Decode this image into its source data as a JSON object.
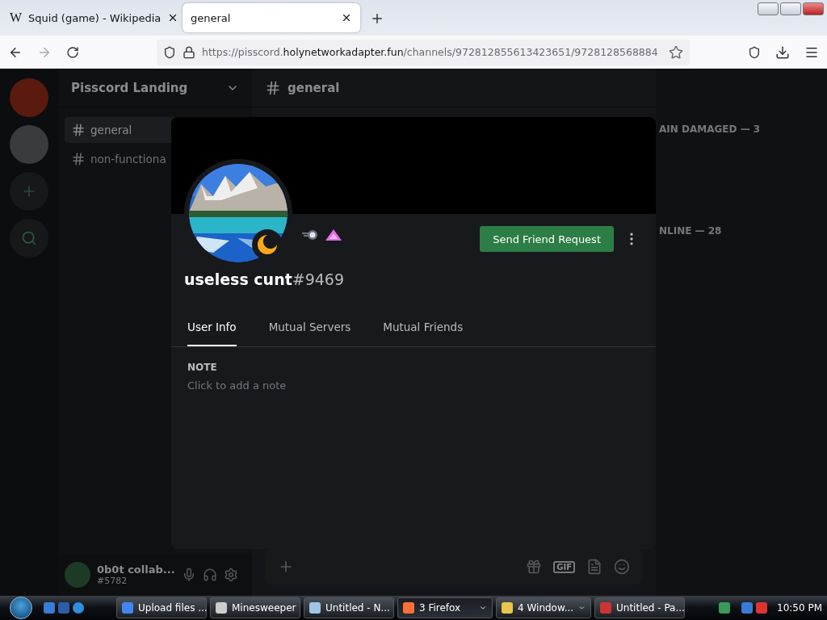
{
  "browser": {
    "tabs": [
      {
        "title": "Squid (game) - Wikipedia",
        "favicon": "W",
        "selected": false
      },
      {
        "title": "general",
        "selected": true
      }
    ],
    "url": {
      "scheme": "https://pisscord.",
      "host": "holynetworkadapter.fun",
      "path": "/channels/972812855613423651/9728128568884"
    }
  },
  "app": {
    "server_name": "Pisscord Landing",
    "channel_header": "general",
    "channels": [
      {
        "name": "general",
        "selected": true
      },
      {
        "name": "non-functiona",
        "selected": false
      }
    ],
    "user": {
      "name": "0b0t collab...",
      "tag": "#5782"
    },
    "member_groups": [
      "AIN DAMAGED — 3",
      "NLINE — 28"
    ],
    "gif_label": "GIF"
  },
  "profile": {
    "button": "Send Friend Request",
    "username": "useless cunt",
    "discriminator": "#9469",
    "tabs": [
      {
        "label": "User Info",
        "selected": true
      },
      {
        "label": "Mutual Servers",
        "selected": false
      },
      {
        "label": "Mutual Friends",
        "selected": false
      }
    ],
    "note_label": "NOTE",
    "note_placeholder": "Click to add a note"
  },
  "taskbar": {
    "tasks": [
      {
        "label": "Upload files ...",
        "kind": "chrome",
        "selected": false
      },
      {
        "label": "Minesweeper",
        "kind": "mine",
        "selected": false
      },
      {
        "label": "Untitled - N...",
        "kind": "notepad",
        "selected": false
      },
      {
        "label": "3 Firefox",
        "kind": "firefox",
        "selected": true,
        "group": true
      },
      {
        "label": "4 Window...",
        "kind": "folder",
        "selected": false,
        "group": true
      },
      {
        "label": "Untitled - Pa...",
        "kind": "paint",
        "selected": false
      }
    ],
    "clock": "10:50 PM"
  }
}
